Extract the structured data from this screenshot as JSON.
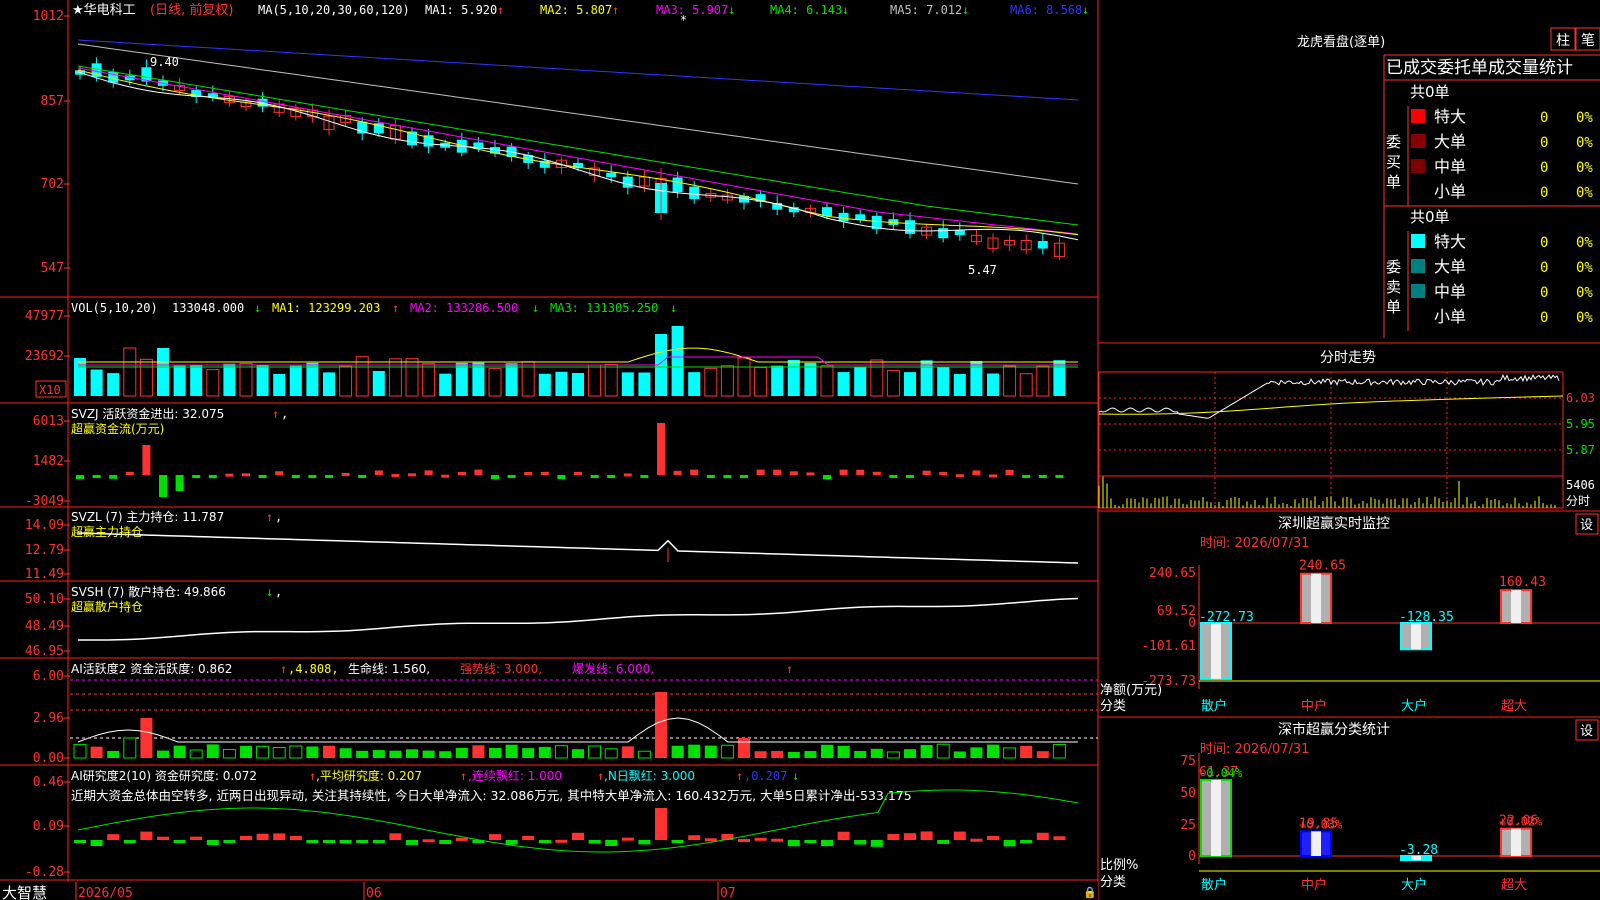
{
  "colors": {
    "up": "#ff3232",
    "down": "#00ffff",
    "green": "#00e000",
    "white": "#ffffff",
    "yellow": "#ffff00",
    "magenta": "#ff00ff",
    "blue": "#3333ff",
    "grey": "#c0c0c0",
    "red": "#ff0000",
    "axis": "#ff3030",
    "label": "#ff4444"
  },
  "main": {
    "stock_name": "★华电科工",
    "period": "(日线, 前复权)",
    "ma_prefix": "MA(5,10,20,30,60,120)",
    "ma": [
      {
        "label": "MA1: 5.920",
        "arrow": "↑"
      },
      {
        "label": "MA2: 5.807",
        "arrow": "↑"
      },
      {
        "label": "MA3: 5.907",
        "arrow": "↓"
      },
      {
        "label": "MA4: 6.143",
        "arrow": "↓"
      },
      {
        "label": "MA5: 7.012",
        "arrow": "↓"
      },
      {
        "label": "MA6: 8.568",
        "arrow": "↓"
      }
    ],
    "y_ticks": [
      "1012",
      "857",
      "702",
      "547"
    ],
    "high_label": "9.40",
    "low_label": "5.47"
  },
  "vol": {
    "title": "VOL(5,10,20)",
    "value": "133048.000",
    "arrow": "↓",
    "ma1": "MA1: 123299.203",
    "ma1_arrow": "↑",
    "ma2": "MA2: 133286.500",
    "ma2_arrow": "↓",
    "ma3": "MA3: 131305.250",
    "ma3_arrow": "↓",
    "y_ticks": [
      "47977",
      "23692"
    ],
    "unit": "X10"
  },
  "svzj": {
    "title": "SVZJ 活跃资金进出: 32.075",
    "arrow": "↑",
    "comma": ",",
    "sub": "超赢资金流(万元)",
    "y_ticks": [
      "6013",
      "1482",
      "-3049"
    ]
  },
  "svzl": {
    "title": "SVZL (7) 主力持仓: 11.787",
    "arrow": "↑",
    "comma": ",",
    "sub": "超赢主力持仓",
    "y_ticks": [
      "14.09",
      "12.79",
      "11.49"
    ]
  },
  "svsh": {
    "title": "SVSH (7) 散户持仓: 49.866",
    "arrow": "↓",
    "comma": ",",
    "sub": "超赢散户持仓",
    "y_ticks": [
      "50.10",
      "48.49",
      "46.95"
    ]
  },
  "ai1": {
    "title": "AI活跃度2 资金活跃度: 0.862",
    "a1": "↑",
    "v2": ",4.808,",
    "l3": "生命线: 1.560,",
    "l4": "强势线: 3.000,",
    "l5": "爆发线: 6.000,",
    "a2": "↑",
    "y_ticks": [
      "6.00",
      "2.96",
      "0.00"
    ]
  },
  "ai2": {
    "title": "AI研究度2(10) 资金研究度: 0.072",
    "a1": "↑",
    "l2": ",平均研究度: 0.207",
    "a2": "↑",
    "l3": ",连续飘红: 1.000",
    "a3": "↑",
    "l4": ",N日飘红: 3.000",
    "a4": "↑",
    "l5": ",0.207",
    "a5": "↓",
    "comment": "近期大资金总体由空转多, 近两日出现异动, 关注其持续性, 今日大单净流入: 32.086万元, 其中特大单净流入: 160.432万元, 大单5日累计净出-533.175",
    "y_ticks": [
      "0.46",
      "0.09",
      "-0.28"
    ]
  },
  "x_axis": {
    "labels": [
      "2026/05",
      "06",
      "07"
    ],
    "brand": "大智慧"
  },
  "right": {
    "lh_title": "龙虎看盘(逐单)",
    "btn_zhu": "柱",
    "btn_bi": "笔",
    "tabs": "已成交委托单成交量统计",
    "buy": {
      "side": "委买单",
      "total": "共0单",
      "rows": [
        {
          "name": "特大",
          "v": "0",
          "p": "0%"
        },
        {
          "name": "大单",
          "v": "0",
          "p": "0%"
        },
        {
          "name": "中单",
          "v": "0",
          "p": "0%"
        },
        {
          "name": "小单",
          "v": "0",
          "p": "0%"
        }
      ]
    },
    "sell": {
      "side": "委卖单",
      "total": "共0单",
      "rows": [
        {
          "name": "特大",
          "v": "0",
          "p": "0%"
        },
        {
          "name": "大单",
          "v": "0",
          "p": "0%"
        },
        {
          "name": "中单",
          "v": "0",
          "p": "0%"
        },
        {
          "name": "小单",
          "v": "0",
          "p": "0%"
        }
      ]
    },
    "fs_title": "分时走势",
    "fs_ticks": [
      "6.03",
      "5.95",
      "5.87"
    ],
    "fs_vol": "5406",
    "fs_unit": "分时",
    "sz_title": "深圳超赢实时监控",
    "sz_btn": "设",
    "sz_time": "时间: 2026/07/31",
    "sz_ticks": [
      "240.65",
      "69.52",
      "0",
      "-101.61",
      "-273.73"
    ],
    "sz_bars": [
      {
        "cat": "散户",
        "value": -272.73,
        "label": "-272.73"
      },
      {
        "cat": "中户",
        "value": 240.65,
        "label": "240.65"
      },
      {
        "cat": "大户",
        "value": -128.35,
        "label": "-128.35"
      },
      {
        "cat": "超大",
        "value": 160.43,
        "label": "160.43"
      }
    ],
    "sz_yl1": "净额(万元)",
    "sz_yl2": "分类",
    "fl_title": "深市超赢分类统计",
    "fl_btn": "设",
    "fl_time": "时间: 2026/07/31",
    "fl_ticks": [
      "75",
      "50",
      "25",
      "0"
    ],
    "fl_bars": [
      {
        "cat": "散户",
        "value": 61.37,
        "label": "61.37",
        "top": "-0.04%"
      },
      {
        "cat": "中户",
        "value": 19.85,
        "label": "19.85",
        "top": "+0.03%"
      },
      {
        "cat": "大户",
        "value": -3.28,
        "label": "-3.28",
        "top": ""
      },
      {
        "cat": "超大",
        "value": 22.06,
        "label": "22.06",
        "top": "+0.02%"
      }
    ],
    "fl_yl1": "比例%",
    "fl_yl2": "分类"
  }
}
